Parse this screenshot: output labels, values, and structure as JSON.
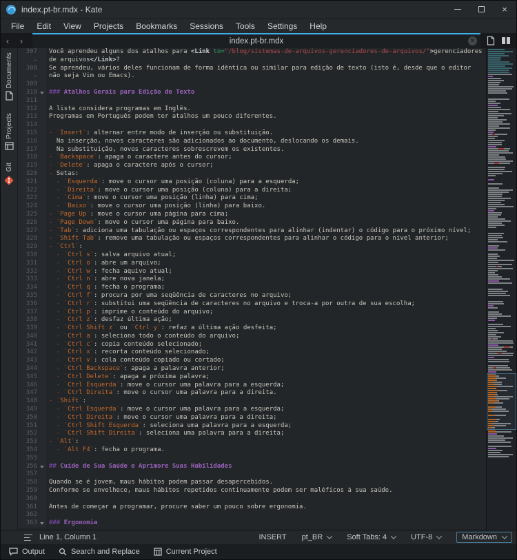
{
  "window": {
    "title": "index.pt-br.mdx - Kate"
  },
  "menubar": {
    "items": [
      "File",
      "Edit",
      "View",
      "Projects",
      "Bookmarks",
      "Sessions",
      "Tools",
      "Settings",
      "Help"
    ]
  },
  "tabbar": {
    "active_tab": "index.pt-br.mdx"
  },
  "sidebar": {
    "tabs": [
      {
        "label": "Documents",
        "icon": "documents-icon"
      },
      {
        "label": "Projects",
        "icon": "projects-icon"
      },
      {
        "label": "Git",
        "icon": "git-icon"
      }
    ]
  },
  "statusbar": {
    "cursor_position": "Line 1, Column 1",
    "input_mode": "INSERT",
    "dictionary": "pt_BR",
    "indent": "Soft Tabs: 4",
    "encoding": "UTF-8",
    "highlight_mode": "Markdown"
  },
  "bottom_toolbar": {
    "items": [
      {
        "label": "Output",
        "icon": "output-icon"
      },
      {
        "label": "Search and Replace",
        "icon": "search-icon"
      },
      {
        "label": "Current Project",
        "icon": "current-project-icon"
      }
    ]
  },
  "colors": {
    "accent": "#3daee9",
    "header": "#9a62bd",
    "code": "#c4692a",
    "bullet": "#a43b3e",
    "attr": "#2f9e63",
    "string": "#ad4a4c"
  },
  "editor": {
    "first_line": 307,
    "lines": [
      {
        "n": 307,
        "seg": [
          [
            "t",
            "Você aprendeu alguns dos atalhos para "
          ],
          [
            "tag",
            "<Link "
          ],
          [
            "attr",
            "to="
          ],
          [
            "str",
            "\"/blog/sistemas-de-arquivos-gerenciadores-de-arquivos/\""
          ],
          [
            "tag",
            ">"
          ],
          [
            "t",
            "gerenciadores"
          ]
        ],
        "wrap": [
          [
            [
              "t",
              "de arquivos"
            ],
            [
              "tag",
              "</Link>"
            ],
            [
              "t",
              "?"
            ]
          ]
        ]
      },
      {
        "n": 308,
        "seg": [
          [
            "t",
            "Se aprendeu, vários deles funcionam de forma idêntica ou similar para edição de texto (isto é, desde que o editor"
          ]
        ],
        "wrap": [
          [
            [
              "t",
              "não seja Vim ou Emacs)."
            ]
          ]
        ]
      },
      {
        "n": 309,
        "seg": []
      },
      {
        "n": 310,
        "fold": true,
        "seg": [
          [
            "hm",
            "###"
          ],
          [
            "h",
            " Atalhos Gerais para Edição de Texto"
          ]
        ]
      },
      {
        "n": 311,
        "seg": []
      },
      {
        "n": 312,
        "seg": [
          [
            "t",
            "A lista considera programas em Inglês."
          ]
        ]
      },
      {
        "n": 313,
        "seg": [
          [
            "t",
            "Programas em Português podem ter atalhos um pouco diferentes."
          ]
        ]
      },
      {
        "n": 314,
        "seg": []
      },
      {
        "n": 315,
        "seg": [
          [
            "b",
            "- "
          ],
          [
            "c",
            "Insert"
          ],
          [
            "t",
            ": alternar entre modo de inserção ou substituição."
          ]
        ]
      },
      {
        "n": 316,
        "seg": [
          [
            "t",
            "  Na inserção, novos caracteres são adicionados ao documento, deslocando os demais."
          ]
        ]
      },
      {
        "n": 317,
        "seg": [
          [
            "t",
            "  Na substituição, novos caracteres sobrescrevem os existentes."
          ]
        ]
      },
      {
        "n": 318,
        "seg": [
          [
            "b",
            "- "
          ],
          [
            "c",
            "Backspace"
          ],
          [
            "t",
            ": apaga o caractere antes do cursor;"
          ]
        ]
      },
      {
        "n": 319,
        "seg": [
          [
            "b",
            "- "
          ],
          [
            "c",
            "Delete"
          ],
          [
            "t",
            ": apaga o caractere após o cursor;"
          ]
        ]
      },
      {
        "n": 320,
        "seg": [
          [
            "b",
            "- "
          ],
          [
            "t",
            "Setas:"
          ]
        ]
      },
      {
        "n": 321,
        "seg": [
          [
            "b",
            "  - "
          ],
          [
            "c",
            "Esquerda"
          ],
          [
            "t",
            ": move o cursor uma posição (coluna) para a esquerda;"
          ]
        ]
      },
      {
        "n": 322,
        "seg": [
          [
            "b",
            "  - "
          ],
          [
            "c",
            "Direita"
          ],
          [
            "t",
            ": move o cursor uma posição (coluna) para a direita;"
          ]
        ]
      },
      {
        "n": 323,
        "seg": [
          [
            "b",
            "  - "
          ],
          [
            "c",
            "Cima"
          ],
          [
            "t",
            ": move o cursor uma posição (linha) para cima;"
          ]
        ]
      },
      {
        "n": 324,
        "seg": [
          [
            "b",
            "  - "
          ],
          [
            "c",
            "Baixo"
          ],
          [
            "t",
            ": move o cursor uma posição (linha) para baixo."
          ]
        ]
      },
      {
        "n": 325,
        "seg": [
          [
            "b",
            "- "
          ],
          [
            "c",
            "Page Up"
          ],
          [
            "t",
            ": move o cursor uma página para cima;"
          ]
        ]
      },
      {
        "n": 326,
        "seg": [
          [
            "b",
            "- "
          ],
          [
            "c",
            "Page Down"
          ],
          [
            "t",
            ": move o cursor uma página para baixo."
          ]
        ]
      },
      {
        "n": 327,
        "seg": [
          [
            "b",
            "- "
          ],
          [
            "c",
            "Tab"
          ],
          [
            "t",
            ": adiciona uma tabulação ou espaços correspondentes para alinhar (indentar) o código para o próximo nível;"
          ]
        ]
      },
      {
        "n": 328,
        "seg": [
          [
            "b",
            "- "
          ],
          [
            "c",
            "Shift Tab"
          ],
          [
            "t",
            ": remove uma tabulação ou espaços correspondentes para alinhar o código para o nível anterior;"
          ]
        ]
      },
      {
        "n": 329,
        "seg": [
          [
            "b",
            "- "
          ],
          [
            "c",
            "Ctrl"
          ],
          [
            "t",
            ":"
          ]
        ]
      },
      {
        "n": 330,
        "seg": [
          [
            "b",
            "  - "
          ],
          [
            "c",
            "Ctrl s"
          ],
          [
            "t",
            ": salva arquivo atual;"
          ]
        ]
      },
      {
        "n": 331,
        "seg": [
          [
            "b",
            "  - "
          ],
          [
            "c",
            "Ctrl o"
          ],
          [
            "t",
            ": abre um arquivo;"
          ]
        ]
      },
      {
        "n": 332,
        "seg": [
          [
            "b",
            "  - "
          ],
          [
            "c",
            "Ctrl w"
          ],
          [
            "t",
            ": fecha aquivo atual;"
          ]
        ]
      },
      {
        "n": 333,
        "seg": [
          [
            "b",
            "  - "
          ],
          [
            "c",
            "Ctrl n"
          ],
          [
            "t",
            ": abre nova janela;"
          ]
        ]
      },
      {
        "n": 334,
        "seg": [
          [
            "b",
            "  - "
          ],
          [
            "c",
            "Ctrl q"
          ],
          [
            "t",
            ": fecha o programa;"
          ]
        ]
      },
      {
        "n": 335,
        "seg": [
          [
            "b",
            "  - "
          ],
          [
            "c",
            "Ctrl f"
          ],
          [
            "t",
            ": procura por uma seqüência de caracteres no arquivo;"
          ]
        ]
      },
      {
        "n": 336,
        "seg": [
          [
            "b",
            "  - "
          ],
          [
            "c",
            "Ctrl r"
          ],
          [
            "t",
            ": substitui uma seqüência de caracteres no arquivo e troca-a por outra de sua escolha;"
          ]
        ]
      },
      {
        "n": 337,
        "seg": [
          [
            "b",
            "  - "
          ],
          [
            "c",
            "Ctrl p"
          ],
          [
            "t",
            ": imprime o conteúdo do arquivo;"
          ]
        ]
      },
      {
        "n": 338,
        "seg": [
          [
            "b",
            "  - "
          ],
          [
            "c",
            "Ctrl z"
          ],
          [
            "t",
            ": desfaz última ação;"
          ]
        ]
      },
      {
        "n": 339,
        "seg": [
          [
            "b",
            "  - "
          ],
          [
            "c",
            "Ctrl Shift z"
          ],
          [
            "t",
            " ou "
          ],
          [
            "c",
            "Ctrl y"
          ],
          [
            "t",
            ": refaz a última ação desfeita;"
          ]
        ]
      },
      {
        "n": 340,
        "seg": [
          [
            "b",
            "  - "
          ],
          [
            "c",
            "Ctrl a"
          ],
          [
            "t",
            ": seleciona todo o conteúdo do arquivo;"
          ]
        ]
      },
      {
        "n": 341,
        "seg": [
          [
            "b",
            "  - "
          ],
          [
            "c",
            "Ctrl c"
          ],
          [
            "t",
            ": copia conteúdo selecionado;"
          ]
        ]
      },
      {
        "n": 342,
        "seg": [
          [
            "b",
            "  - "
          ],
          [
            "c",
            "Ctrl x"
          ],
          [
            "t",
            ": recorta conteúdo selecionado;"
          ]
        ]
      },
      {
        "n": 343,
        "seg": [
          [
            "b",
            "  - "
          ],
          [
            "c",
            "Ctrl v"
          ],
          [
            "t",
            ": cola conteúdo copiado ou cortado;"
          ]
        ]
      },
      {
        "n": 344,
        "seg": [
          [
            "b",
            "  - "
          ],
          [
            "c",
            "Ctrl Backspace"
          ],
          [
            "t",
            ": apaga a palavra anterior;"
          ]
        ]
      },
      {
        "n": 345,
        "seg": [
          [
            "b",
            "  - "
          ],
          [
            "c",
            "Ctrl Delete"
          ],
          [
            "t",
            ": apaga a próxima palavra;"
          ]
        ]
      },
      {
        "n": 346,
        "seg": [
          [
            "b",
            "  - "
          ],
          [
            "c",
            "Ctrl Esquerda"
          ],
          [
            "t",
            ": move o cursor uma palavra para a esquerda;"
          ]
        ]
      },
      {
        "n": 347,
        "seg": [
          [
            "b",
            "  - "
          ],
          [
            "c",
            "Ctrl Direita"
          ],
          [
            "t",
            ": move o cursor uma palavra para a direita."
          ]
        ]
      },
      {
        "n": 348,
        "seg": [
          [
            "b",
            "- "
          ],
          [
            "c",
            "Shift"
          ],
          [
            "t",
            ":"
          ]
        ]
      },
      {
        "n": 349,
        "seg": [
          [
            "b",
            "  - "
          ],
          [
            "c",
            "Ctrl Esquerda"
          ],
          [
            "t",
            ": move o cursor uma palavra para a esquerda;"
          ]
        ]
      },
      {
        "n": 350,
        "seg": [
          [
            "b",
            "  - "
          ],
          [
            "c",
            "Ctrl Direita"
          ],
          [
            "t",
            ": move o cursor uma palavra para a direita;"
          ]
        ]
      },
      {
        "n": 351,
        "seg": [
          [
            "b",
            "  - "
          ],
          [
            "c",
            "Ctrl Shift Esquerda"
          ],
          [
            "t",
            ": seleciona uma palavra para a esquerda;"
          ]
        ]
      },
      {
        "n": 352,
        "seg": [
          [
            "b",
            "  - "
          ],
          [
            "c",
            "Ctrl Shift Direita"
          ],
          [
            "t",
            ": seleciona uma palavra para a direita;"
          ]
        ]
      },
      {
        "n": 353,
        "seg": [
          [
            "b",
            "- "
          ],
          [
            "c",
            "Alt"
          ],
          [
            "t",
            ":"
          ]
        ]
      },
      {
        "n": 354,
        "seg": [
          [
            "b",
            "  - "
          ],
          [
            "c",
            "Alt F4"
          ],
          [
            "t",
            ": fecha o programa."
          ]
        ]
      },
      {
        "n": 355,
        "seg": []
      },
      {
        "n": 356,
        "fold": true,
        "seg": [
          [
            "hm",
            "##"
          ],
          [
            "h",
            " Cuide de Sua Saúde e Aprimore Suas Habilidades"
          ]
        ]
      },
      {
        "n": 357,
        "seg": []
      },
      {
        "n": 358,
        "seg": [
          [
            "t",
            "Quando se é jovem, maus hábitos podem passar desapercebidos."
          ]
        ]
      },
      {
        "n": 359,
        "seg": [
          [
            "t",
            "Conforme se envelhece, maus hábitos repetidos continuamente podem ser maléficos à sua saúde."
          ]
        ]
      },
      {
        "n": 360,
        "seg": []
      },
      {
        "n": 361,
        "seg": [
          [
            "t",
            "Antes de começar a programar, procure saber um pouco sobre ergonomia."
          ]
        ]
      },
      {
        "n": 362,
        "seg": []
      },
      {
        "n": 363,
        "fold": true,
        "seg": [
          [
            "hm",
            "###"
          ],
          [
            "h",
            " Ergonomia"
          ]
        ]
      }
    ]
  }
}
